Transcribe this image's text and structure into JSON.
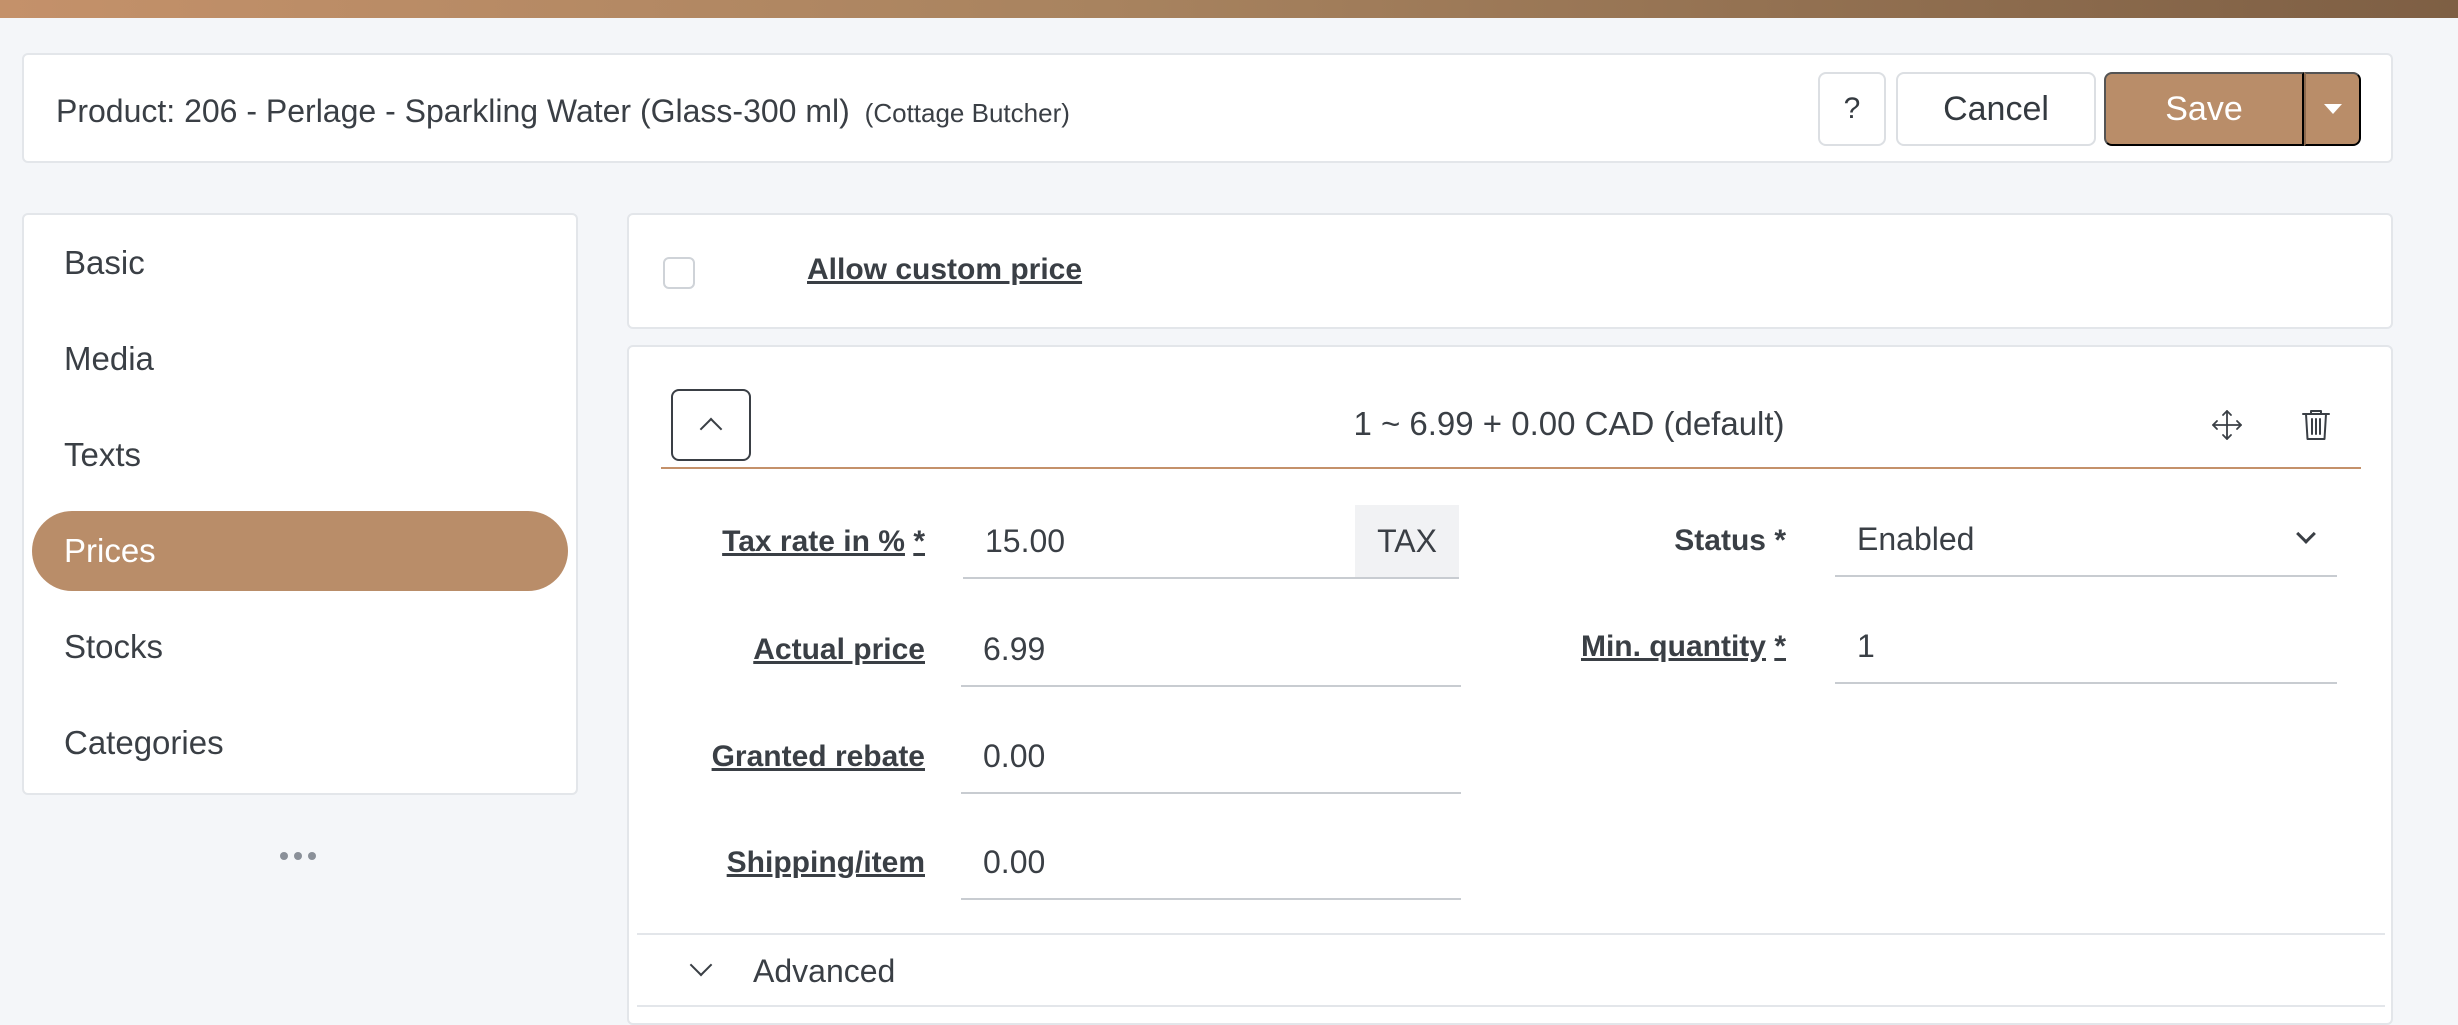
{
  "header": {
    "title": "Product: 206 - Perlage - Sparkling Water (Glass-300 ml)",
    "subtitle": "(Cottage Butcher)",
    "help_label": "?",
    "cancel_label": "Cancel",
    "save_label": "Save"
  },
  "sidebar": {
    "items": [
      {
        "label": "Basic",
        "active": false
      },
      {
        "label": "Media",
        "active": false
      },
      {
        "label": "Texts",
        "active": false
      },
      {
        "label": "Prices",
        "active": true
      },
      {
        "label": "Stocks",
        "active": false
      },
      {
        "label": "Categories",
        "active": false
      }
    ]
  },
  "custom_price": {
    "label": "Allow custom price",
    "checked": false
  },
  "price_entry": {
    "summary": "1 ~ 6.99 + 0.00 CAD (default)",
    "fields": {
      "tax_rate": {
        "label": "Tax rate in %",
        "required": "*",
        "value": "15.00",
        "addon": "TAX"
      },
      "actual_price": {
        "label": "Actual price",
        "value": "6.99"
      },
      "granted_rebate": {
        "label": "Granted rebate",
        "value": "0.00"
      },
      "shipping": {
        "label": "Shipping/item",
        "value": "0.00"
      },
      "status": {
        "label": "Status",
        "required": "*",
        "value": "Enabled"
      },
      "min_quantity": {
        "label": "Min. quantity",
        "required": "*",
        "value": "1"
      }
    },
    "advanced_label": "Advanced"
  },
  "colors": {
    "accent": "#b98d69",
    "accent_dark": "#8d6a4e",
    "border": "#e3e6ea",
    "text": "#3a3f45"
  }
}
